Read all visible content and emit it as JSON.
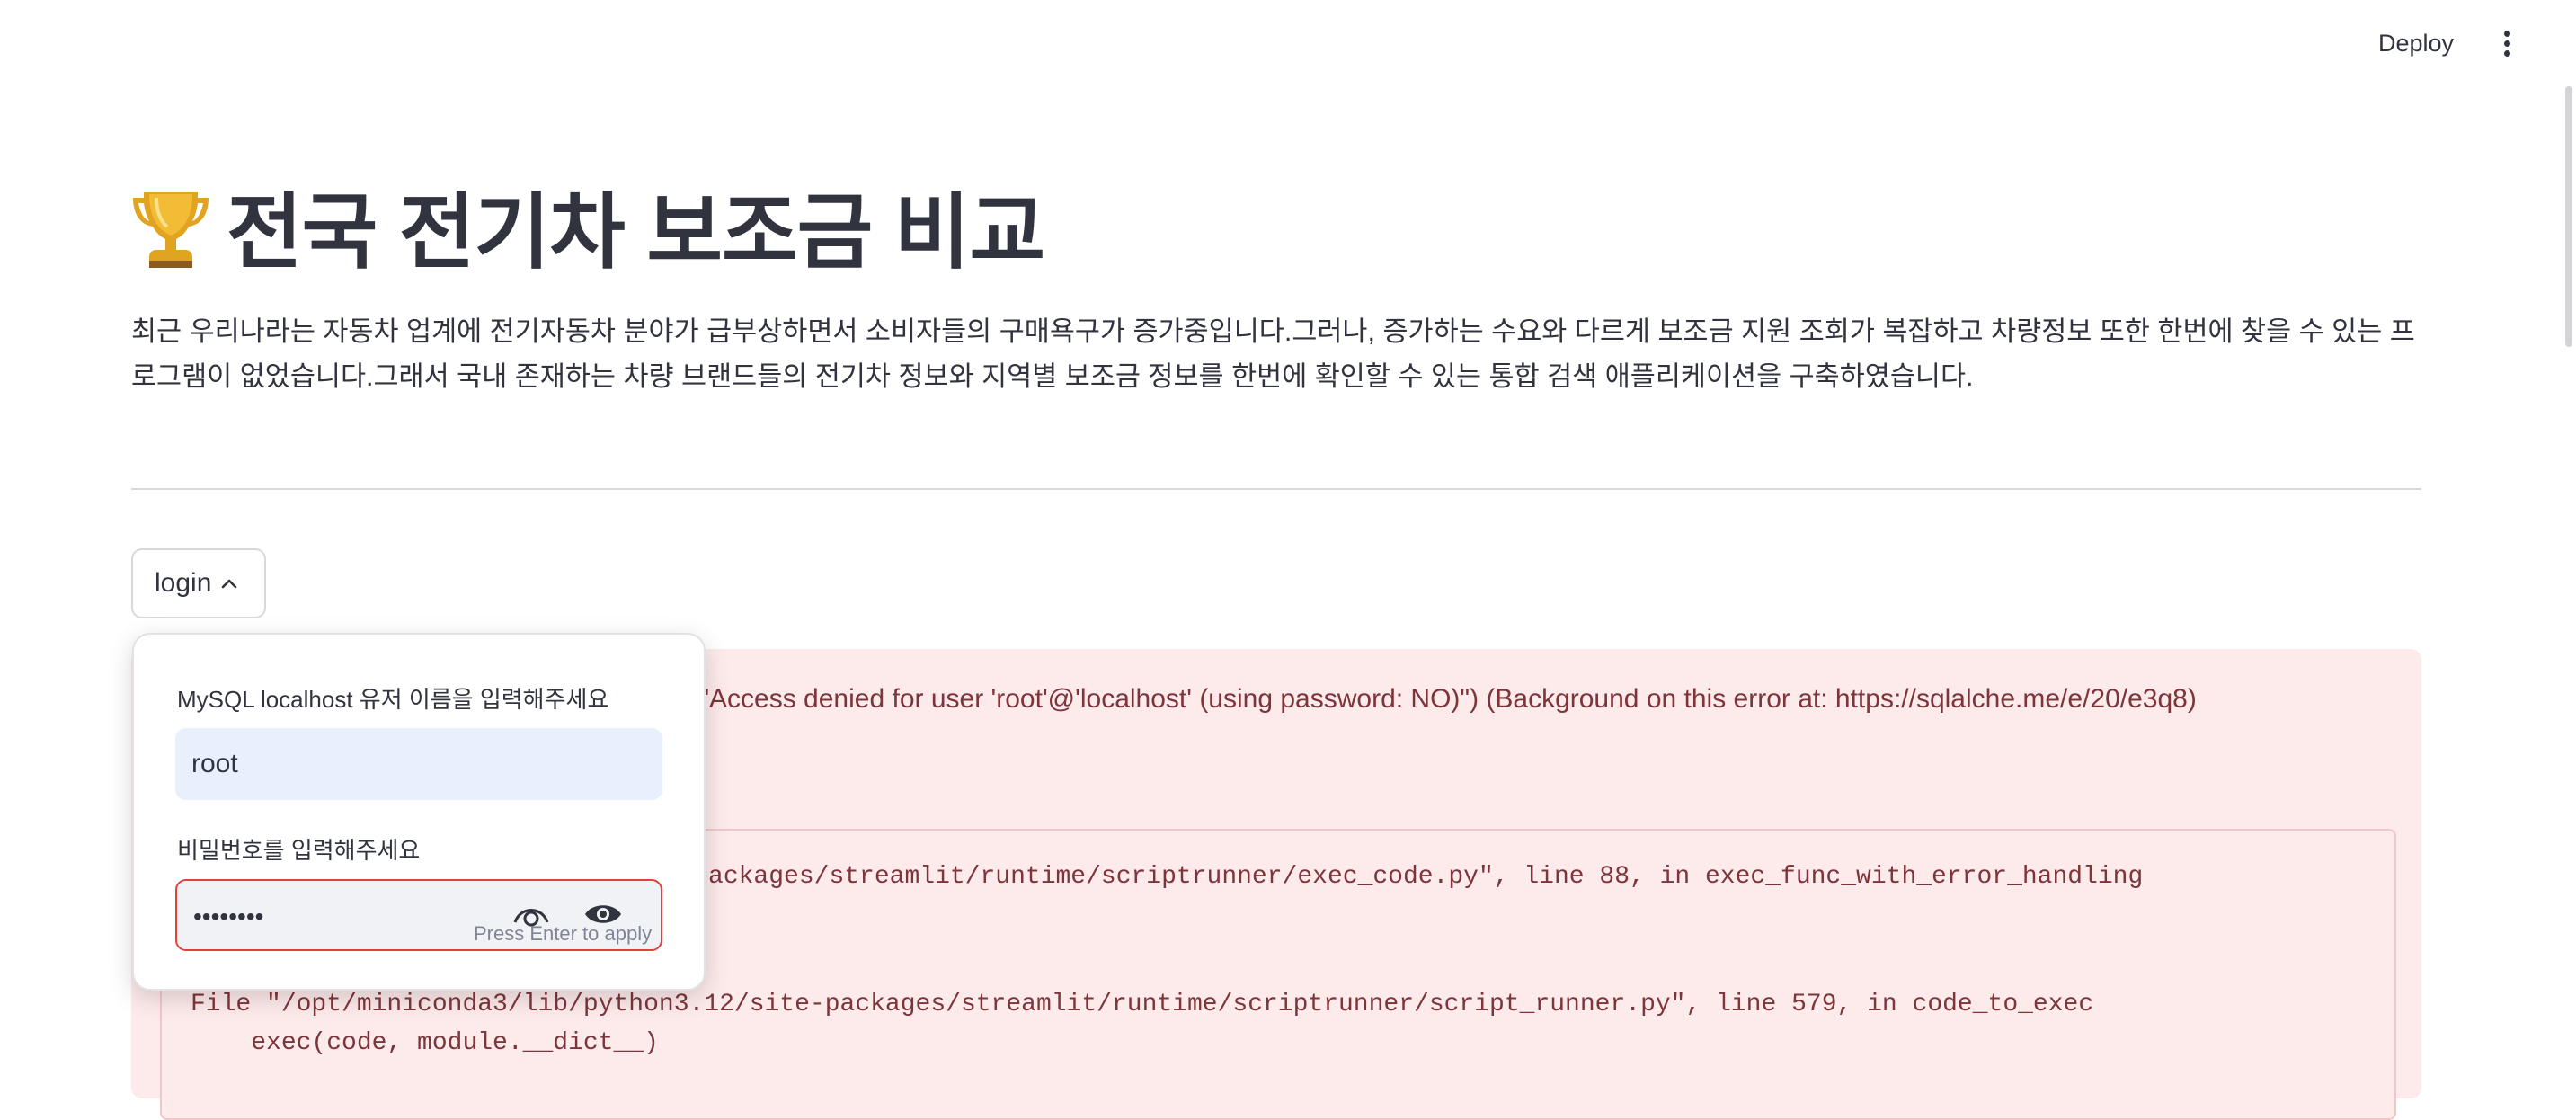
{
  "header": {
    "deploy_label": "Deploy",
    "menu_icon": "vertical-dots-icon"
  },
  "page": {
    "title": "전국 전기차 보조금 비교",
    "title_icon": "trophy-icon",
    "description": "최근 우리나라는 자동차 업계에 전기자동차 분야가 급부상하면서 소비자들의 구매욕구가 증가중입니다.그러나, 증가하는 수요와 다르게 보조금 지원 조회가 복잡하고 차량정보 또한 한번에 찾을 수 있는 프로그램이 없었습니다.그래서 국내 존재하는 차량 브랜드들의 전기차 정보와 지역별 보조금 정보를 한번에 확인할 수 있는 통합 검색 애플리케이션을 구축하였습니다."
  },
  "expander": {
    "label": "login"
  },
  "login": {
    "user_label": "MySQL localhost 유저 이름을 입력해주세요",
    "user_value": "root",
    "password_label": "비밀번호를 입력해주세요",
    "password_value": "••••••••",
    "hint": "Press Enter to apply"
  },
  "error": {
    "message": "rror) (1045, \"Access denied for user 'root'@'localhost' (using password: NO)\") (Background on this error at: https://sqlalche.me/e/20/e3q8)",
    "trace": [
      ".12/site-packages/streamlit/runtime/scriptrunner/exec_code.py\", line 88, in exec_func_with_error_handling",
      "File \"/opt/miniconda3/lib/python3.12/site-packages/streamlit/runtime/scriptrunner/script_runner.py\", line 579, in code_to_exec",
      "    exec(code, module.__dict__)"
    ]
  },
  "colors": {
    "text": "#31333f",
    "error_bg": "#fdeaea",
    "error_text": "#7d353b",
    "input_bg": "#e8f0fe",
    "focus_border": "#e0413f"
  }
}
